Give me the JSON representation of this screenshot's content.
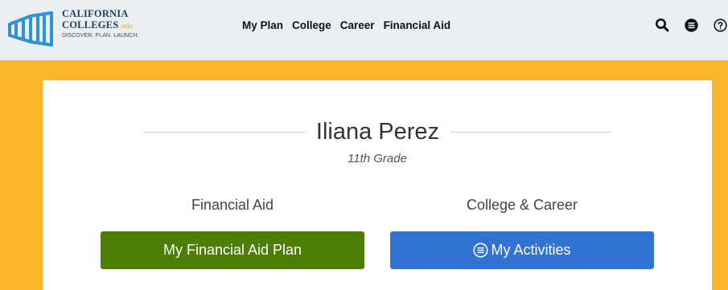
{
  "header": {
    "logo": {
      "line1": "CALIFORNIA",
      "line2": "COLLEGES",
      "edu": ".edu",
      "tagline": "DISCOVER. PLAN. LAUNCH."
    },
    "nav": [
      "My Plan",
      "College",
      "Career",
      "Financial Aid"
    ],
    "icons": [
      "search-icon",
      "menu-icon",
      "help-icon"
    ]
  },
  "profile": {
    "name": "Iliana Perez",
    "grade": "11th Grade"
  },
  "sections": {
    "left_label": "Financial Aid",
    "right_label": "College & Career",
    "left_button": "My Financial Aid Plan",
    "right_button": "My Activities"
  },
  "colors": {
    "page_background": "#fbb62b",
    "header_background": "#eceff1",
    "financial_aid_button": "#4c7e06",
    "activities_button": "#3073d2",
    "logo_blue": "#1f3f68",
    "logo_accent": "#f4a51c"
  }
}
